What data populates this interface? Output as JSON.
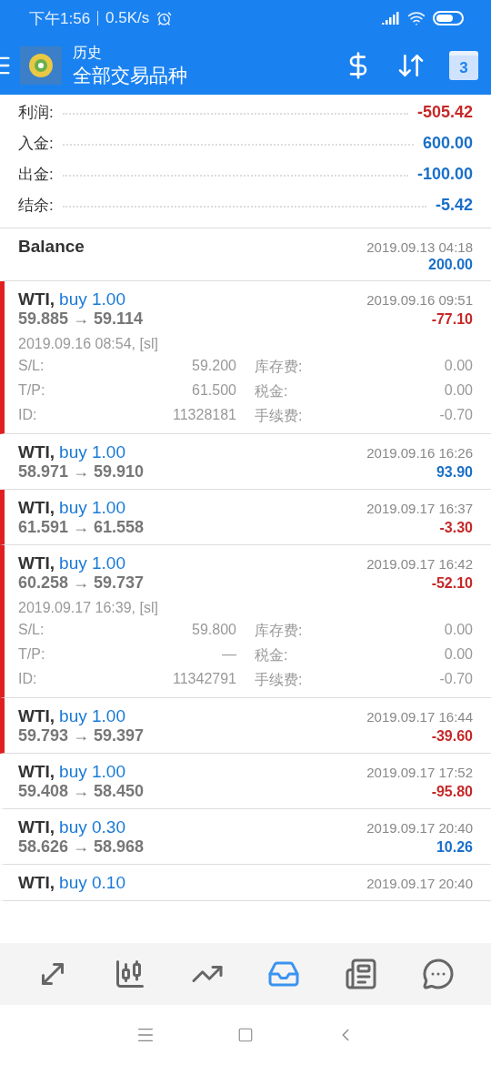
{
  "status_bar": {
    "time": "下午1:56",
    "speed": "0.5K/s"
  },
  "header": {
    "subtitle": "历史",
    "title": "全部交易品种",
    "calendar_day": "3"
  },
  "summary": [
    {
      "label": "利润:",
      "value": "-505.42",
      "loss": true
    },
    {
      "label": "入金:",
      "value": "600.00",
      "loss": false
    },
    {
      "label": "出金:",
      "value": "-100.00",
      "loss": false
    },
    {
      "label": "结余:",
      "value": "-5.42",
      "loss": false
    }
  ],
  "balance": {
    "label": "Balance",
    "time": "2019.09.13 04:18",
    "amount": "200.00"
  },
  "trades": [
    {
      "symbol": "WTI,",
      "side": "buy 1.00",
      "time": "2019.09.16 09:51",
      "prices": "59.885 → 59.114",
      "profit": "-77.10",
      "loss": true,
      "marked": true,
      "expanded": true,
      "open_time": "2019.09.16 08:54, [sl]",
      "details": [
        {
          "label": "S/L:",
          "value": "59.200",
          "fee_label": "库存费:",
          "fee": "0.00"
        },
        {
          "label": "T/P:",
          "value": "61.500",
          "fee_label": "税金:",
          "fee": "0.00"
        },
        {
          "label": "ID:",
          "value": "11328181",
          "fee_label": "手续费:",
          "fee": "-0.70"
        }
      ]
    },
    {
      "symbol": "WTI,",
      "side": "buy 1.00",
      "time": "2019.09.16 16:26",
      "prices": "58.971 → 59.910",
      "profit": "93.90",
      "loss": false,
      "marked": false,
      "expanded": false
    },
    {
      "symbol": "WTI,",
      "side": "buy 1.00",
      "time": "2019.09.17 16:37",
      "prices": "61.591 → 61.558",
      "profit": "-3.30",
      "loss": true,
      "marked": true,
      "expanded": false
    },
    {
      "symbol": "WTI,",
      "side": "buy 1.00",
      "time": "2019.09.17 16:42",
      "prices": "60.258 → 59.737",
      "profit": "-52.10",
      "loss": true,
      "marked": true,
      "expanded": true,
      "open_time": "2019.09.17 16:39, [sl]",
      "details": [
        {
          "label": "S/L:",
          "value": "59.800",
          "fee_label": "库存费:",
          "fee": "0.00"
        },
        {
          "label": "T/P:",
          "value": "—",
          "fee_label": "税金:",
          "fee": "0.00"
        },
        {
          "label": "ID:",
          "value": "11342791",
          "fee_label": "手续费:",
          "fee": "-0.70"
        }
      ]
    },
    {
      "symbol": "WTI,",
      "side": "buy 1.00",
      "time": "2019.09.17 16:44",
      "prices": "59.793 → 59.397",
      "profit": "-39.60",
      "loss": true,
      "marked": true,
      "expanded": false
    },
    {
      "symbol": "WTI,",
      "side": "buy 1.00",
      "time": "2019.09.17 17:52",
      "prices": "59.408 → 58.450",
      "profit": "-95.80",
      "loss": true,
      "marked": false,
      "expanded": false
    },
    {
      "symbol": "WTI,",
      "side": "buy 0.30",
      "time": "2019.09.17 20:40",
      "prices": "58.626 → 58.968",
      "profit": "10.26",
      "loss": false,
      "marked": false,
      "expanded": false
    },
    {
      "symbol": "WTI,",
      "side": "buy 0.10",
      "time": "2019.09.17 20:40",
      "marked": false,
      "expanded": false
    }
  ],
  "bottom_nav": [
    {
      "kind": "quotes",
      "selected": false
    },
    {
      "kind": "chart",
      "selected": false
    },
    {
      "kind": "trade",
      "selected": false
    },
    {
      "kind": "history",
      "selected": true
    },
    {
      "kind": "news",
      "selected": false
    },
    {
      "kind": "chat",
      "selected": false
    }
  ]
}
